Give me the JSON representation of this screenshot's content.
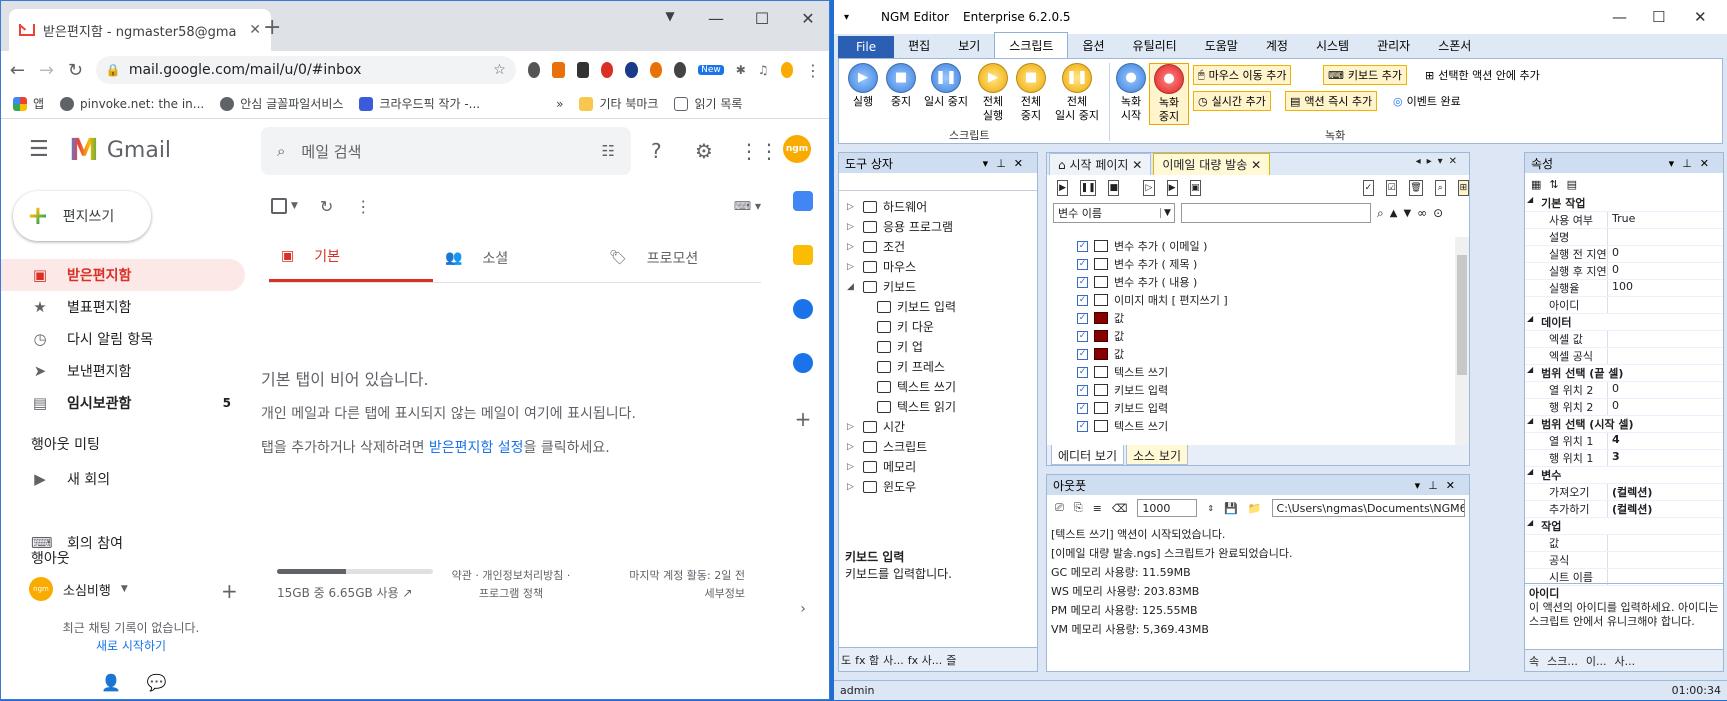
{
  "chrome": {
    "tab_title": "받은편지함 - ngmaster58@gma",
    "url": "mail.google.com/mail/u/0/#inbox",
    "bookmarks": [
      "앱",
      "pinvoke.net: the in...",
      "안심 글꼴파일서비스",
      "크라우드픽 작가 -...",
      "기타 북마크",
      "읽기 목록"
    ],
    "ext_badge": "New"
  },
  "gmail": {
    "logo": "Gmail",
    "search_placeholder": "메일 검색",
    "avatar_text": "ngm",
    "compose": "편지쓰기",
    "nav": [
      {
        "label": "받은편지함",
        "icon": "inbox-icon",
        "count": ""
      },
      {
        "label": "별표편지함",
        "icon": "star-icon",
        "count": ""
      },
      {
        "label": "다시 알림 항목",
        "icon": "clock-icon",
        "count": ""
      },
      {
        "label": "보낸편지함",
        "icon": "send-icon",
        "count": ""
      },
      {
        "label": "임시보관함",
        "icon": "draft-icon",
        "count": "5"
      }
    ],
    "meet_heading": "행아웃 미팅",
    "meet_items": [
      "새 회의",
      "회의 참여"
    ],
    "hangouts_heading": "행아웃",
    "hangouts_user": "소심비행",
    "no_chat": "최근 채팅 기록이 없습니다.",
    "start_new": "새로 시작하기",
    "tabs": [
      "기본",
      "소셜",
      "프로모션"
    ],
    "empty_title": "기본 탭이 비어 있습니다.",
    "empty_line1": "개인 메일과 다른 탭에 표시되지 않는 메일이 여기에 표시됩니다.",
    "empty_line2_pre": "탭을 추가하거나 삭제하려면 ",
    "empty_line2_link": "받은편지함 설정",
    "empty_line2_post": "을 클릭하세요.",
    "storage_text": "15GB 중 6.65GB 사용",
    "storage_fraction": 0.443,
    "policy_1": "약관 · 개인정보처리방침 ·",
    "policy_2": "프로그램 정책",
    "last_activity_1": "마지막 계정 활동: 2일 전",
    "last_activity_2": "세부정보"
  },
  "ngm": {
    "title_app": "NGM Editor",
    "title_edition": "Enterprise 6.2.0.5",
    "ribbon_tabs": [
      "File",
      "편집",
      "보기",
      "스크립트",
      "옵션",
      "유틸리티",
      "도움말",
      "계정",
      "시스템",
      "관리자",
      "스폰서"
    ],
    "ribbon_active": "스크립트",
    "script_buttons": [
      "실행",
      "중지",
      "일시 중지",
      "전체\n실행",
      "전체\n중지",
      "전체\n일시 중지"
    ],
    "record_buttons": [
      "녹화\n시작",
      "녹화\n중지"
    ],
    "record_small": [
      "마우스 이동 추가",
      "키보드 추가",
      "선택한 액션 안에 추가",
      "실시간 추가",
      "액션 즉시 추가",
      "이벤트 완료"
    ],
    "group_script": "스크립트",
    "group_record": "녹화",
    "toolbox_title": "도구 상자",
    "tree": [
      {
        "label": "하드웨어",
        "sub": false,
        "arrow": "▷"
      },
      {
        "label": "응용 프로그램",
        "sub": false,
        "arrow": "▷"
      },
      {
        "label": "조건",
        "sub": false,
        "arrow": "▷"
      },
      {
        "label": "마우스",
        "sub": false,
        "arrow": "▷"
      },
      {
        "label": "키보드",
        "sub": false,
        "arrow": "◢"
      },
      {
        "label": "키보드 입력",
        "sub": true,
        "arrow": ""
      },
      {
        "label": "키 다운",
        "sub": true,
        "arrow": ""
      },
      {
        "label": "키 업",
        "sub": true,
        "arrow": ""
      },
      {
        "label": "키 프레스",
        "sub": true,
        "arrow": ""
      },
      {
        "label": "텍스트 쓰기",
        "sub": true,
        "arrow": ""
      },
      {
        "label": "텍스트 읽기",
        "sub": true,
        "arrow": ""
      },
      {
        "label": "시간",
        "sub": false,
        "arrow": "▷"
      },
      {
        "label": "스크립트",
        "sub": false,
        "arrow": "▷"
      },
      {
        "label": "메모리",
        "sub": false,
        "arrow": "▷"
      },
      {
        "label": "윈도우",
        "sub": false,
        "arrow": "▷"
      }
    ],
    "toolbox_desc_title": "키보드 입력",
    "toolbox_desc": "키보드를 입력합니다.",
    "toolbox_footer": [
      "도",
      "fx 함",
      "사...",
      "fx 사...",
      "즐"
    ],
    "editor_tabs": [
      "시작 페이지",
      "이메일 대량 발송"
    ],
    "var_select": "변수 이름",
    "actions": [
      {
        "label": "변수 추가 ( 이메일 )",
        "red": false
      },
      {
        "label": "변수 추가 ( 제목 )",
        "red": false
      },
      {
        "label": "변수 추가 ( 내용 )",
        "red": false
      },
      {
        "label": "이미지 매치 [ 편지쓰기 ]",
        "red": false
      },
      {
        "label": "값",
        "red": true
      },
      {
        "label": "값",
        "red": true
      },
      {
        "label": "값",
        "red": true
      },
      {
        "label": "텍스트 쓰기",
        "red": false
      },
      {
        "label": "키보드 입력",
        "red": false
      },
      {
        "label": "키보드 입력",
        "red": false
      },
      {
        "label": "텍스트 쓰기",
        "red": false
      }
    ],
    "editor_footer": [
      "에디터 보기",
      "소스 보기"
    ],
    "output_title": "아웃풋",
    "output_count": "1000",
    "output_path": "C:\\Users\\ngmas\\Documents\\NGM6\\",
    "output_lines": [
      "[텍스트 쓰기] 액션이 시작되었습니다.",
      "[이메일 대량 발송.ngs] 스크립트가 완료되었습니다.",
      "GC 메모리 사용량: 11.59MB",
      "WS 메모리 사용량: 203.83MB",
      "PM 메모리 사용량: 125.55MB",
      "VM 메모리 사용량: 5,369.43MB"
    ],
    "props_title": "속성",
    "props": [
      {
        "k": "기본 작업",
        "v": "",
        "cat": true
      },
      {
        "k": "사용 여부",
        "v": "True",
        "bold": false
      },
      {
        "k": "설명",
        "v": "",
        "bold": false
      },
      {
        "k": "실행 전 지연",
        "v": "0",
        "bold": false
      },
      {
        "k": "실행 후 지연",
        "v": "0",
        "bold": false
      },
      {
        "k": "실행율",
        "v": "100",
        "bold": false
      },
      {
        "k": "아이디",
        "v": "",
        "bold": false
      },
      {
        "k": "데이터",
        "v": "",
        "cat": true
      },
      {
        "k": "엑셀 값",
        "v": "",
        "bold": false
      },
      {
        "k": "엑셀 공식",
        "v": "",
        "bold": false
      },
      {
        "k": "범위 선택 (끝 셀)",
        "v": "",
        "cat": true
      },
      {
        "k": "열 위치 2",
        "v": "0",
        "bold": false
      },
      {
        "k": "행 위치 2",
        "v": "0",
        "bold": false
      },
      {
        "k": "범위 선택 (시작 셀)",
        "v": "",
        "cat": true
      },
      {
        "k": "열 위치 1",
        "v": "4",
        "bold": true
      },
      {
        "k": "행 위치 1",
        "v": "3",
        "bold": true
      },
      {
        "k": "변수",
        "v": "",
        "cat": true
      },
      {
        "k": "가져오기",
        "v": "(컬렉션)",
        "bold": true
      },
      {
        "k": "추가하기",
        "v": "(컬렉션)",
        "bold": true
      },
      {
        "k": "작업",
        "v": "",
        "cat": true
      },
      {
        "k": "값",
        "v": "",
        "bold": false
      },
      {
        "k": "공식",
        "v": "",
        "bold": false
      },
      {
        "k": "시트 이름",
        "v": "",
        "bold": false
      }
    ],
    "prop_desc_title": "아이디",
    "prop_desc": "이 액션의 아이디를 입력하세요. 아이디는 스크립트 안에서 유니크해야 합니다.",
    "props_footer": [
      "속",
      "스크...",
      "이...",
      "사..."
    ],
    "status_user": "admin",
    "status_time": "01:00:34"
  }
}
